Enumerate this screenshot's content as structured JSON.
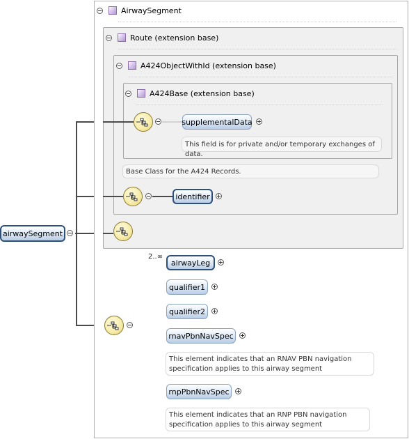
{
  "root_element": {
    "label": "airwaySegment"
  },
  "groups": {
    "airway_segment": {
      "label": "AirwaySegment"
    },
    "route": {
      "label": "Route (extension base)"
    },
    "a424_object_with_id": {
      "label": "A424ObjectWithId (extension base)"
    },
    "a424_base": {
      "label": "A424Base (extension base)"
    }
  },
  "elements": {
    "supplemental_data": {
      "label": "supplementalData",
      "doc": "This field is for private and/or temporary exchanges of data."
    },
    "identifier": {
      "label": "identifier"
    },
    "airway_leg": {
      "label": "airwayLeg",
      "cardinality": "2..∞"
    },
    "qualifier1": {
      "label": "qualifier1"
    },
    "qualifier2": {
      "label": "qualifier2"
    },
    "rnav_pbn_nav_spec": {
      "label": "rnavPbnNavSpec",
      "doc_line1": "This element indicates that an RNAV PBN navigation",
      "doc_line2": "specification applies to this airway segment"
    },
    "rnp_pbn_nav_spec": {
      "label": "rnpPbnNavSpec",
      "doc_line1": "This element indicates that an RNP PBN navigation",
      "doc_line2": "specification applies to this airway segment"
    }
  },
  "annotations": {
    "a424_object_with_id_doc": "Base Class for the A424 Records."
  },
  "icons": [
    "collapse-minus-icon",
    "expand-plus-icon",
    "complex-type-icon",
    "sequence-compositor-icon"
  ],
  "colors": {
    "element_border": "#4c6f96",
    "element_fill": "#d4e1f0",
    "compositor_fill": "#f6eba6",
    "group_fill": "#f0f0f0"
  }
}
